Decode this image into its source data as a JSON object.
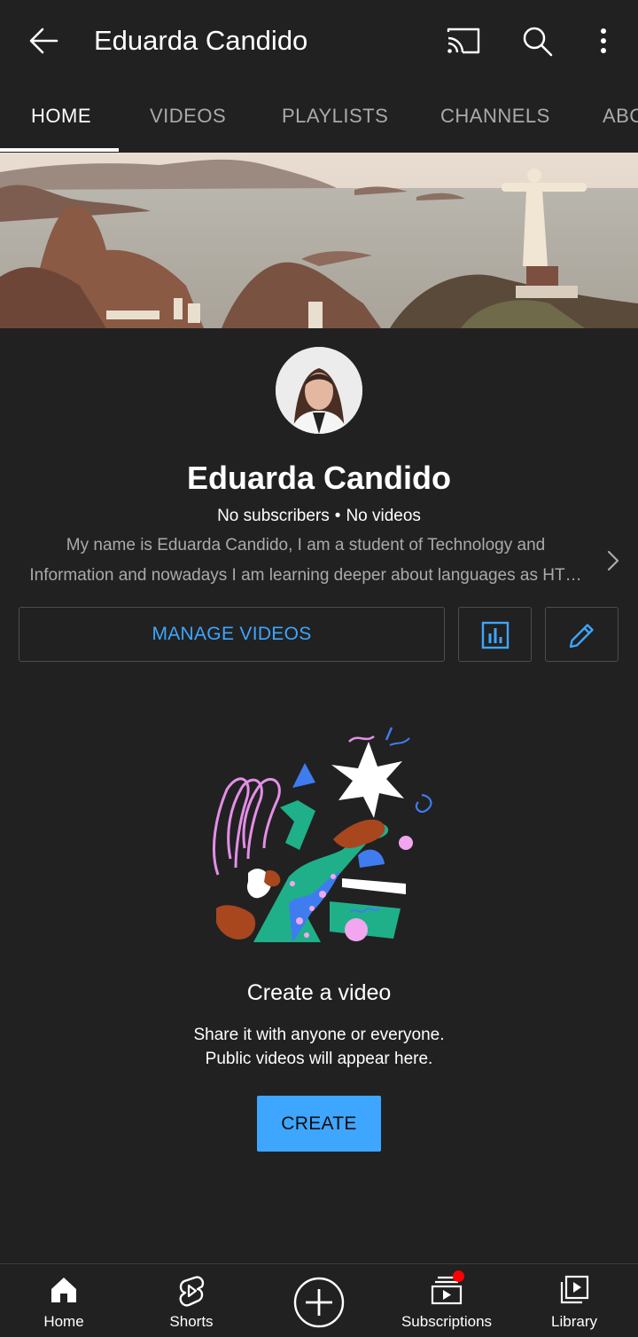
{
  "header": {
    "title": "Eduarda Candido",
    "icons": [
      "back-arrow-icon",
      "cast-icon",
      "search-icon",
      "more-vert-icon"
    ]
  },
  "tabs": [
    {
      "label": "HOME",
      "active": true
    },
    {
      "label": "VIDEOS",
      "active": false
    },
    {
      "label": "PLAYLISTS",
      "active": false
    },
    {
      "label": "CHANNELS",
      "active": false
    },
    {
      "label": "ABOUT",
      "active": false
    }
  ],
  "channel": {
    "name": "Eduarda Candido",
    "subscribers": "No subscribers",
    "separator": "•",
    "videos": "No videos",
    "description_line1": "My name is Eduarda Candido, I am a student of Technology and",
    "description_line2": "Information and nowadays I am learning deeper about languages as HT…"
  },
  "actions": {
    "manage_videos": "MANAGE VIDEOS",
    "analytics_icon": "analytics-icon",
    "edit_icon": "pencil-icon"
  },
  "empty_state": {
    "title": "Create a video",
    "subtitle_line1": "Share it with anyone or everyone.",
    "subtitle_line2": "Public videos will appear here.",
    "button": "CREATE"
  },
  "bottom_nav": [
    {
      "label": "Home",
      "icon": "home-icon"
    },
    {
      "label": "Shorts",
      "icon": "shorts-icon"
    },
    {
      "label": "",
      "icon": "add-circle-icon"
    },
    {
      "label": "Subscriptions",
      "icon": "subscriptions-icon",
      "badge": true
    },
    {
      "label": "Library",
      "icon": "library-icon"
    }
  ],
  "colors": {
    "background": "#212121",
    "accent": "#3ea6ff",
    "muted_text": "#aaaaaa",
    "badge": "#ff0000"
  }
}
